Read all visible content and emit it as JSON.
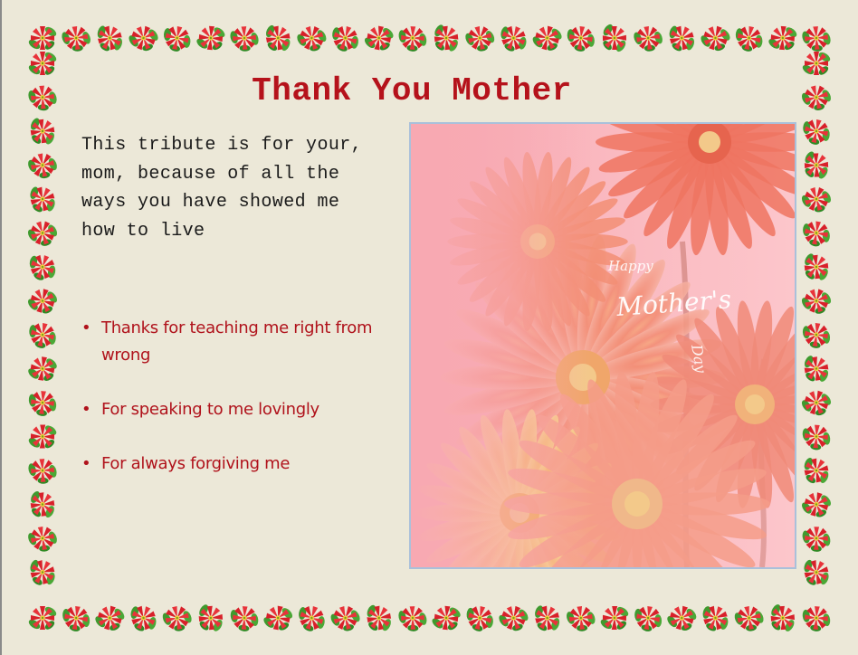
{
  "card": {
    "title": "Thank You Mother",
    "tribute": "This tribute is for your, mom, because of all the ways you have showed me how to live",
    "bullets": [
      "Thanks for teaching me right from wrong",
      "For speaking to me lovingly",
      "For always forgiving me"
    ]
  },
  "photo": {
    "caption_line1": "Happy",
    "caption_line2": "Mother's",
    "caption_line3": "Day"
  },
  "colors": {
    "background": "#ece8d8",
    "title": "#b5121b",
    "bullet_text": "#b0121b",
    "body_text": "#1a1a1a",
    "photo_frame": "#aac0da",
    "poinsettia_red": "#d8202a",
    "leaf_green": "#3f9a2e"
  },
  "decor": {
    "border_icon": "poinsettia-icon"
  }
}
